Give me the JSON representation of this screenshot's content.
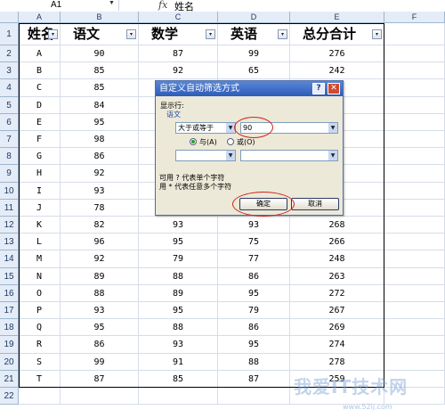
{
  "formula_bar": {
    "name_box": "A1",
    "fx": "fx",
    "content": "姓名"
  },
  "columns": [
    "A",
    "B",
    "C",
    "D",
    "E",
    "F"
  ],
  "rows": [
    "1",
    "2",
    "3",
    "4",
    "5",
    "6",
    "7",
    "8",
    "9",
    "10",
    "11",
    "12",
    "13",
    "14",
    "15",
    "16",
    "17",
    "18",
    "19",
    "20",
    "21",
    "22"
  ],
  "table": {
    "headers": [
      "姓名",
      "语文",
      "数学",
      "英语",
      "总分合计"
    ],
    "filter_button": "▾",
    "data": [
      [
        "A",
        "90",
        "87",
        "99",
        "276"
      ],
      [
        "B",
        "85",
        "92",
        "65",
        "242"
      ],
      [
        "C",
        "85",
        "",
        "",
        ""
      ],
      [
        "D",
        "84",
        "",
        "",
        ""
      ],
      [
        "E",
        "95",
        "",
        "",
        ""
      ],
      [
        "F",
        "98",
        "",
        "",
        ""
      ],
      [
        "G",
        "86",
        "",
        "",
        ""
      ],
      [
        "H",
        "92",
        "",
        "",
        ""
      ],
      [
        "I",
        "93",
        "",
        "",
        ""
      ],
      [
        "J",
        "78",
        "",
        "",
        ""
      ],
      [
        "K",
        "82",
        "93",
        "93",
        "268"
      ],
      [
        "L",
        "96",
        "95",
        "75",
        "266"
      ],
      [
        "M",
        "92",
        "79",
        "77",
        "248"
      ],
      [
        "N",
        "89",
        "88",
        "86",
        "263"
      ],
      [
        "O",
        "88",
        "89",
        "95",
        "272"
      ],
      [
        "P",
        "93",
        "95",
        "79",
        "267"
      ],
      [
        "Q",
        "95",
        "88",
        "86",
        "269"
      ],
      [
        "R",
        "86",
        "93",
        "95",
        "274"
      ],
      [
        "S",
        "99",
        "91",
        "88",
        "278"
      ],
      [
        "T",
        "87",
        "85",
        "87",
        "259"
      ]
    ]
  },
  "dialog": {
    "title": "自定义自动筛选方式",
    "help": "?",
    "close": "✕",
    "show_rows": "显示行:",
    "field": "语文",
    "condition1_operator": "大于或等于",
    "condition1_value": "90",
    "and_label": "与(A)",
    "or_label": "或(O)",
    "and_selected": true,
    "condition2_operator": "",
    "condition2_value": "",
    "hint1": "可用 ? 代表单个字符",
    "hint2": "用 * 代表任意多个字符",
    "ok": "确定",
    "cancel": "取消",
    "arrow": "▼"
  },
  "watermark": {
    "text": "我爱IT技术网",
    "url": "www.52ij.com"
  },
  "colors": {
    "header_bg": "#e4ecf7",
    "title_bar": "#2c5cb8",
    "dialog_bg": "#ece9d8",
    "highlight": "#d02020"
  }
}
